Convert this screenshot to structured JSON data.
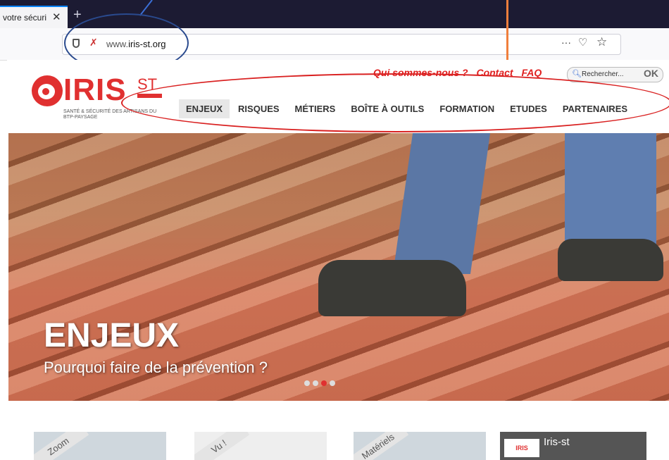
{
  "browser": {
    "tab_title": "votre sécuri",
    "tab_close": "✕",
    "new_tab": "+",
    "url_domain_prefix": "www.",
    "url_domain": "iris-st.org",
    "page_actions": "···"
  },
  "site": {
    "top_links": [
      "Qui sommes-nous ?",
      "Contact",
      "FAQ"
    ],
    "search_placeholder": "Rechercher...",
    "search_button": "OK",
    "logo": {
      "name": "IRIS",
      "sup": "ST",
      "tagline": "SANTÉ & SÉCURITÉ DES ARTISANS DU BTP-PAYSAGE"
    },
    "nav": [
      {
        "label": "ENJEUX",
        "active": true
      },
      {
        "label": "RISQUES",
        "active": false
      },
      {
        "label": "MÉTIERS",
        "active": false
      },
      {
        "label": "BOÎTE À OUTILS",
        "active": false
      },
      {
        "label": "FORMATION",
        "active": false
      },
      {
        "label": "ETUDES",
        "active": false
      },
      {
        "label": "PARTENAIRES",
        "active": false
      }
    ],
    "hero": {
      "title": "ENJEUX",
      "subtitle": "Pourquoi faire de la prévention ?",
      "slide_count": 4,
      "current_slide": 3
    },
    "cards": [
      {
        "ribbon": "Zoom"
      },
      {
        "ribbon": "Vu !"
      },
      {
        "ribbon": "Matériels"
      },
      {
        "name": "Iris-st"
      }
    ]
  }
}
